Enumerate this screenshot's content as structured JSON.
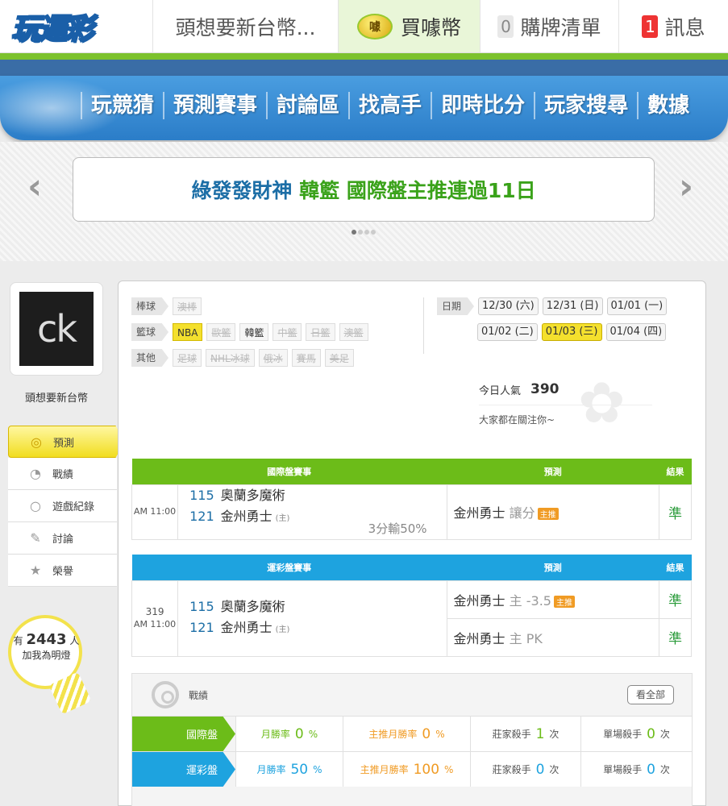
{
  "topbar": {
    "logo": "玩運彩",
    "user": "頭想要新台幣...",
    "coin_icon": "噱",
    "buy": "買噱幣",
    "cart_count": "0",
    "cart": "購牌清單",
    "msg_count": "1",
    "msg": "訊息"
  },
  "nav": [
    "玩競猜",
    "預測賽事",
    "討論區",
    "找高手",
    "即時比分",
    "玩家搜尋",
    "數據"
  ],
  "banner": {
    "part1": "綠發發財神",
    "part2": "韓籃 國際盤主推連過11日"
  },
  "sidebar": {
    "avatar_text": "ck",
    "username": "頭想要新台幣",
    "menu": [
      "預測",
      "戰績",
      "遊戲紀錄",
      "討論",
      "榮譽"
    ],
    "fans_prefix": "有",
    "fans_count": "2443",
    "fans_suffix": "人",
    "fans_text": "加我為明燈"
  },
  "filters": {
    "baseball": {
      "label": "棒球",
      "items": [
        "澳棒"
      ]
    },
    "basketball": {
      "label": "籃球",
      "items": [
        "NBA",
        "歐籃",
        "韓籃",
        "中籃",
        "日籃",
        "澳籃"
      ]
    },
    "other": {
      "label": "其他",
      "items": [
        "足球",
        "NHL冰球",
        "俄冰",
        "賽馬",
        "美足"
      ]
    }
  },
  "dates": {
    "label": "日期",
    "row1": [
      "12/30 (六)",
      "12/31 (日)",
      "01/01 (一)"
    ],
    "row2": [
      "01/02 (二)",
      "01/03 (三)",
      "01/04 (四)"
    ]
  },
  "popularity": {
    "label": "今日人氣",
    "value": "390",
    "watch": "大家都在關注你~"
  },
  "intl": {
    "header": "國際盤賽事",
    "pred_header": "預測",
    "result_header": "結果",
    "time": "AM 11:00",
    "away_num": "115",
    "away": "奧蘭多魔術",
    "home_num": "121",
    "home": "金州勇士",
    "home_mark": "(主)",
    "odds": "3分輸50%",
    "pred_team": "金州勇士",
    "pred_type": "讓分",
    "badge": "主推",
    "result": "準"
  },
  "local": {
    "header": "運彩盤賽事",
    "pred_header": "預測",
    "result_header": "結果",
    "game_no": "319",
    "time": "AM 11:00",
    "away_num": "115",
    "away": "奧蘭多魔術",
    "home_num": "121",
    "home": "金州勇士",
    "home_mark": "(主)",
    "pred1_team": "金州勇士",
    "pred1_type": "主 -3.5",
    "badge": "主推",
    "result1": "準",
    "pred2_team": "金州勇士",
    "pred2_type": "主 PK",
    "result2": "準"
  },
  "stats": {
    "title": "戰績",
    "all_button": "看全部",
    "rows": [
      {
        "label": "國際盤",
        "month_rate_label": "月勝率",
        "month_rate": "0",
        "main_rate_label": "主推月勝率",
        "main_rate": "0",
        "banker_label": "莊家殺手",
        "banker": "1",
        "single_label": "單場殺手",
        "single": "0"
      },
      {
        "label": "運彩盤",
        "month_rate_label": "月勝率",
        "month_rate": "50",
        "main_rate_label": "主推月勝率",
        "main_rate": "100",
        "banker_label": "莊家殺手",
        "banker": "0",
        "single_label": "單場殺手",
        "single": "0"
      }
    ],
    "pct": "%",
    "times": "次"
  }
}
